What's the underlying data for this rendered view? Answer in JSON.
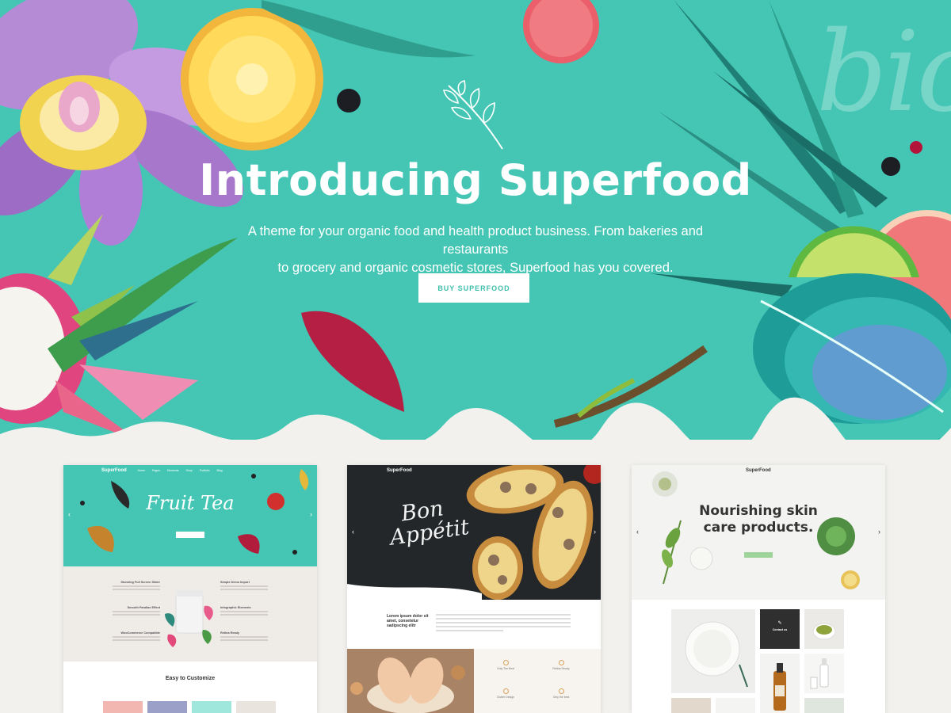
{
  "hero": {
    "title": "Introducing Superfood",
    "subtitle_line1": "A theme for your organic food and health product business. From bakeries and restaurants",
    "subtitle_line2": "to grocery and organic cosmetic stores, Superfood has you covered.",
    "cta_label": "BUY SUPERFOOD",
    "watermark": "bio",
    "background_color": "#45c6b4"
  },
  "previews": {
    "fruit_tea": {
      "logo": "SuperFood",
      "menu": [
        "Home",
        "Pages",
        "Elements",
        "Shop",
        "Portfolio",
        "Blog"
      ],
      "title": "Fruit Tea",
      "features": [
        "Stunning Full Screen Slider",
        "Simple Demo Import",
        "Smooth Parallax Effect",
        "Infographic Elements",
        "WooCommerce Compatible",
        "Retina Ready"
      ],
      "customize_title": "Easy to Customize"
    },
    "bon_appetit": {
      "logo": "SuperFood",
      "script_line1": "Bon",
      "script_line2": "Appétit",
      "intro_heading": "Lorem ipsum dolor sit amet, consetetur sadipscing elitr",
      "features": [
        "Only The Best",
        "Retina Ready",
        "Clutter Design",
        "Only the best"
      ]
    },
    "skin_care": {
      "logo": "SuperFood",
      "title_line1": "Nourishing skin",
      "title_line2": "care products.",
      "contact_label": "Contact us"
    }
  },
  "colors": {
    "accent": "#45c6b4",
    "button_text": "#3fbfad",
    "page_bg": "#f3f1ed"
  }
}
